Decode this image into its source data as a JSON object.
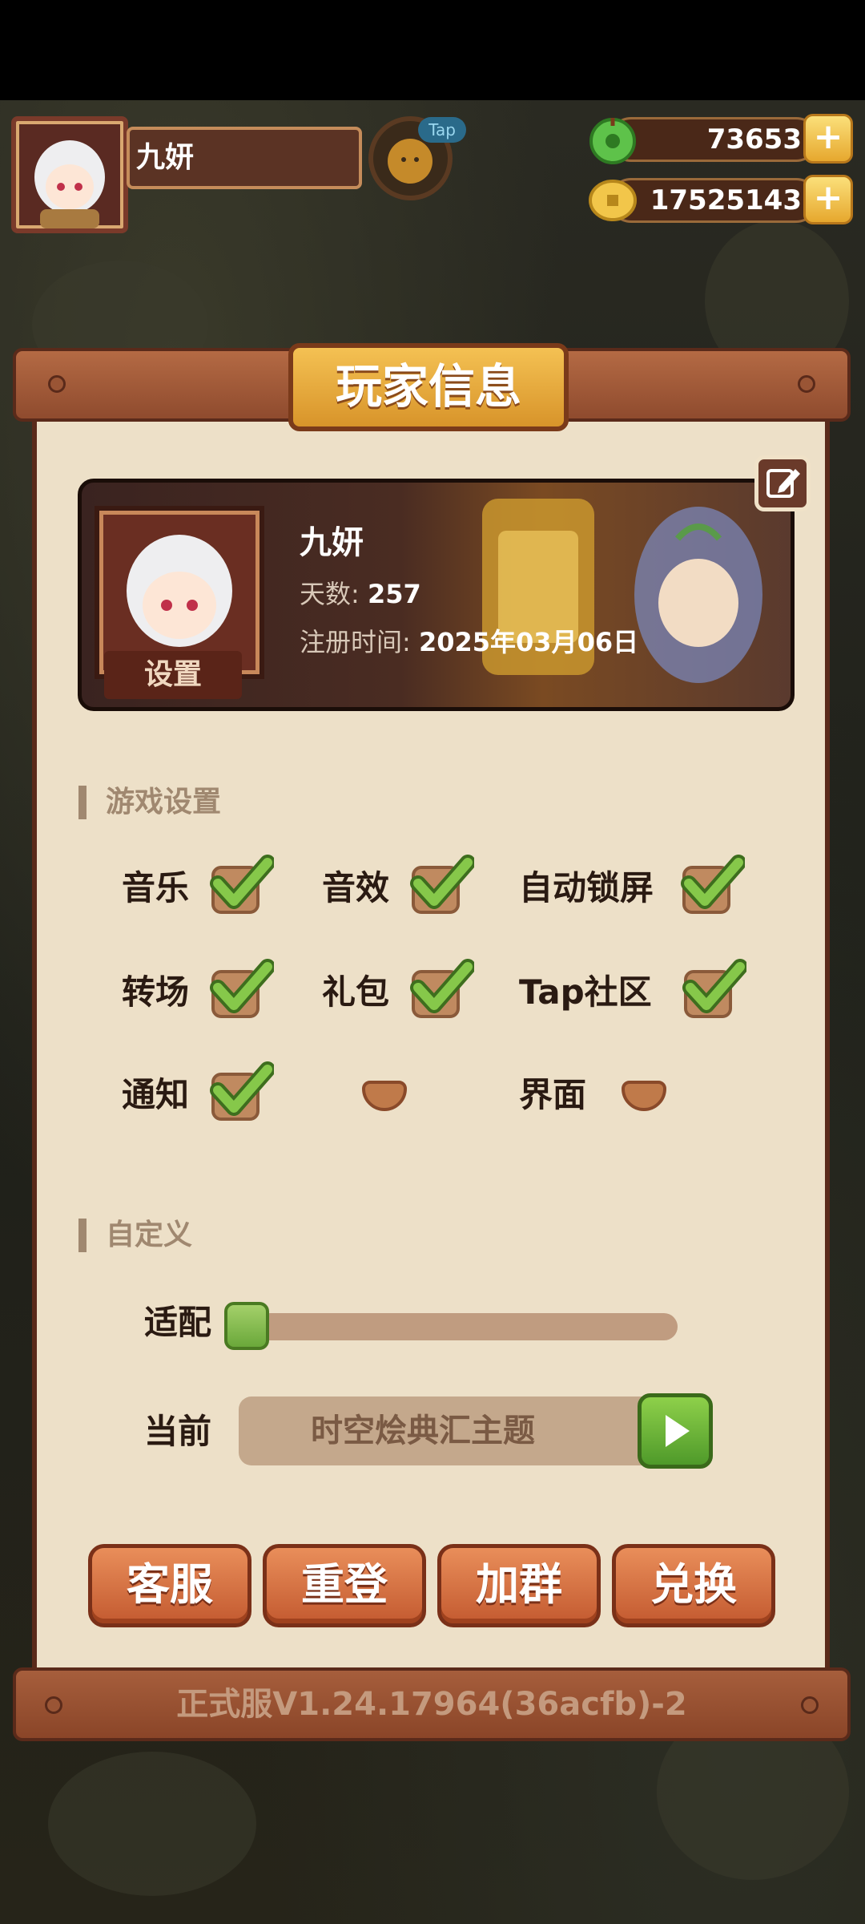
{
  "hud": {
    "player_name": "九妍",
    "tap_badge": "Tap",
    "jade_amount": "73653",
    "coin_amount": "17525143",
    "plus_label": "+"
  },
  "panel": {
    "title": "玩家信息",
    "profile": {
      "name": "九妍",
      "days_label": "天数",
      "days_value": "257",
      "register_label": "注册时间",
      "register_value": "2025年03月06日",
      "settings_tag": "设置"
    },
    "game_settings": {
      "title": "游戏设置",
      "options": [
        {
          "label": "音乐",
          "checked": true
        },
        {
          "label": "音效",
          "checked": true
        },
        {
          "label": "自动锁屏",
          "checked": true
        },
        {
          "label": "转场",
          "checked": true
        },
        {
          "label": "礼包",
          "checked": true
        },
        {
          "label": "Tap社区",
          "checked": true
        },
        {
          "label": "通知",
          "checked": true
        },
        {
          "label": "",
          "checked": false
        },
        {
          "label": "界面",
          "checked": false
        }
      ]
    },
    "custom": {
      "title": "自定义",
      "fit_label": "适配",
      "fit_value": 0,
      "current_label": "当前",
      "current_theme": "时空烩典汇主题"
    },
    "buttons": [
      "客服",
      "重登",
      "加群",
      "兑换"
    ],
    "version": "正式服V1.24.17964(36acfb)-2"
  },
  "colors": {
    "wood": "#8f4b2e",
    "paper": "#ede0c8",
    "gold": "#e6a82e",
    "check_green": "#7bc043",
    "button_orange": "#d46e3e"
  },
  "icons": [
    "jade-icon",
    "coin-icon",
    "plus-icon",
    "edit-icon",
    "check-icon",
    "play-icon"
  ]
}
